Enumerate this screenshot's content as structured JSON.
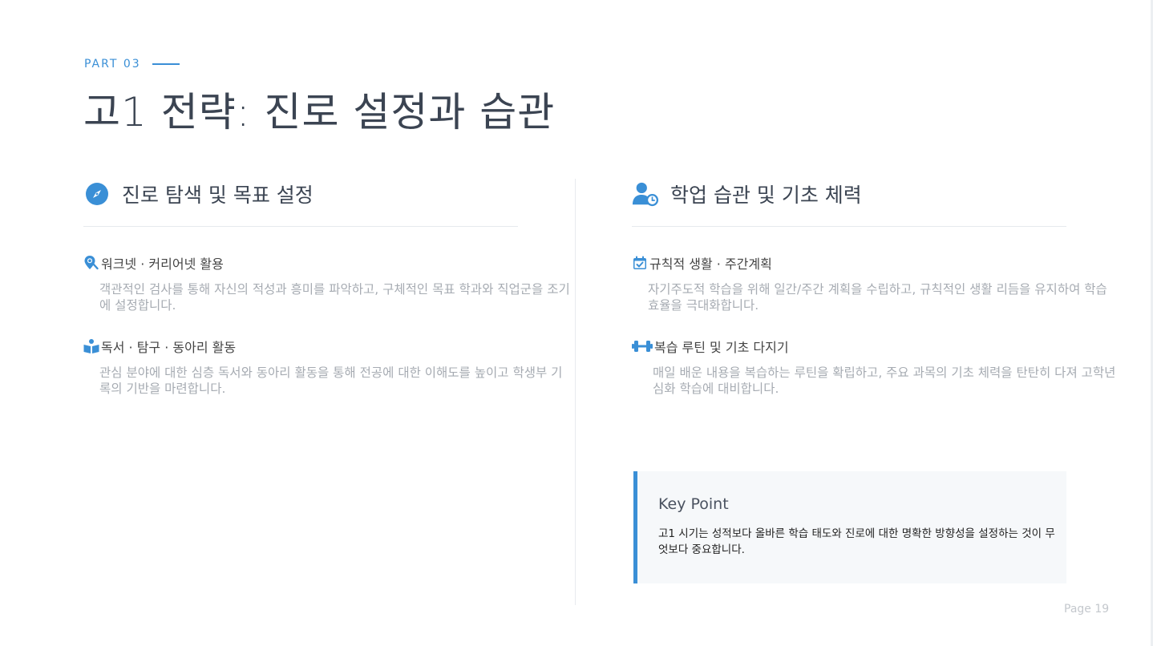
{
  "header": {
    "part_label": "PART 03",
    "title": "고1 전략: 진로 설정과 습관"
  },
  "left": {
    "section_icon": "compass-icon",
    "section_title": "진로 탐색 및 목표 설정",
    "items": [
      {
        "icon": "map-pin-search-icon",
        "title": "워크넷 · 커리어넷 활용",
        "desc": "객관적인 검사를 통해 자신의 적성과 흥미를 파악하고, 구체적인 목표 학과와 직업군을 조기에 설정합니다."
      },
      {
        "icon": "book-reader-icon",
        "title": "독서 · 탐구 · 동아리 활동",
        "desc": "관심 분야에 대한 심층 독서와 동아리 활동을 통해 전공에 대한 이해도를 높이고 학생부 기록의 기반을 마련합니다."
      }
    ]
  },
  "right": {
    "section_icon": "user-clock-icon",
    "section_title": "학업 습관 및 기초 체력",
    "items": [
      {
        "icon": "calendar-check-icon",
        "title": "규칙적 생활 · 주간계획",
        "desc": "자기주도적 학습을 위해 일간/주간 계획을 수립하고, 규칙적인 생활 리듬을 유지하여 학습 효율을 극대화합니다."
      },
      {
        "icon": "dumbbell-icon",
        "title": "복습 루틴 및 기초 다지기",
        "desc": "매일 배운 내용을 복습하는 루틴을 확립하고, 주요 과목의 기초 체력을 탄탄히 다져 고학년 심화 학습에 대비합니다."
      }
    ]
  },
  "key_point": {
    "title": "Key Point",
    "text": "고1 시기는 성적보다 올바른 학습 태도와 진로에 대한 명확한 방향성을 설정하는 것이 무엇보다 중요합니다."
  },
  "footer": {
    "page": "Page 19"
  },
  "colors": {
    "accent": "#3a8fd6",
    "title": "#3b4452",
    "muted": "#a6abb2"
  }
}
